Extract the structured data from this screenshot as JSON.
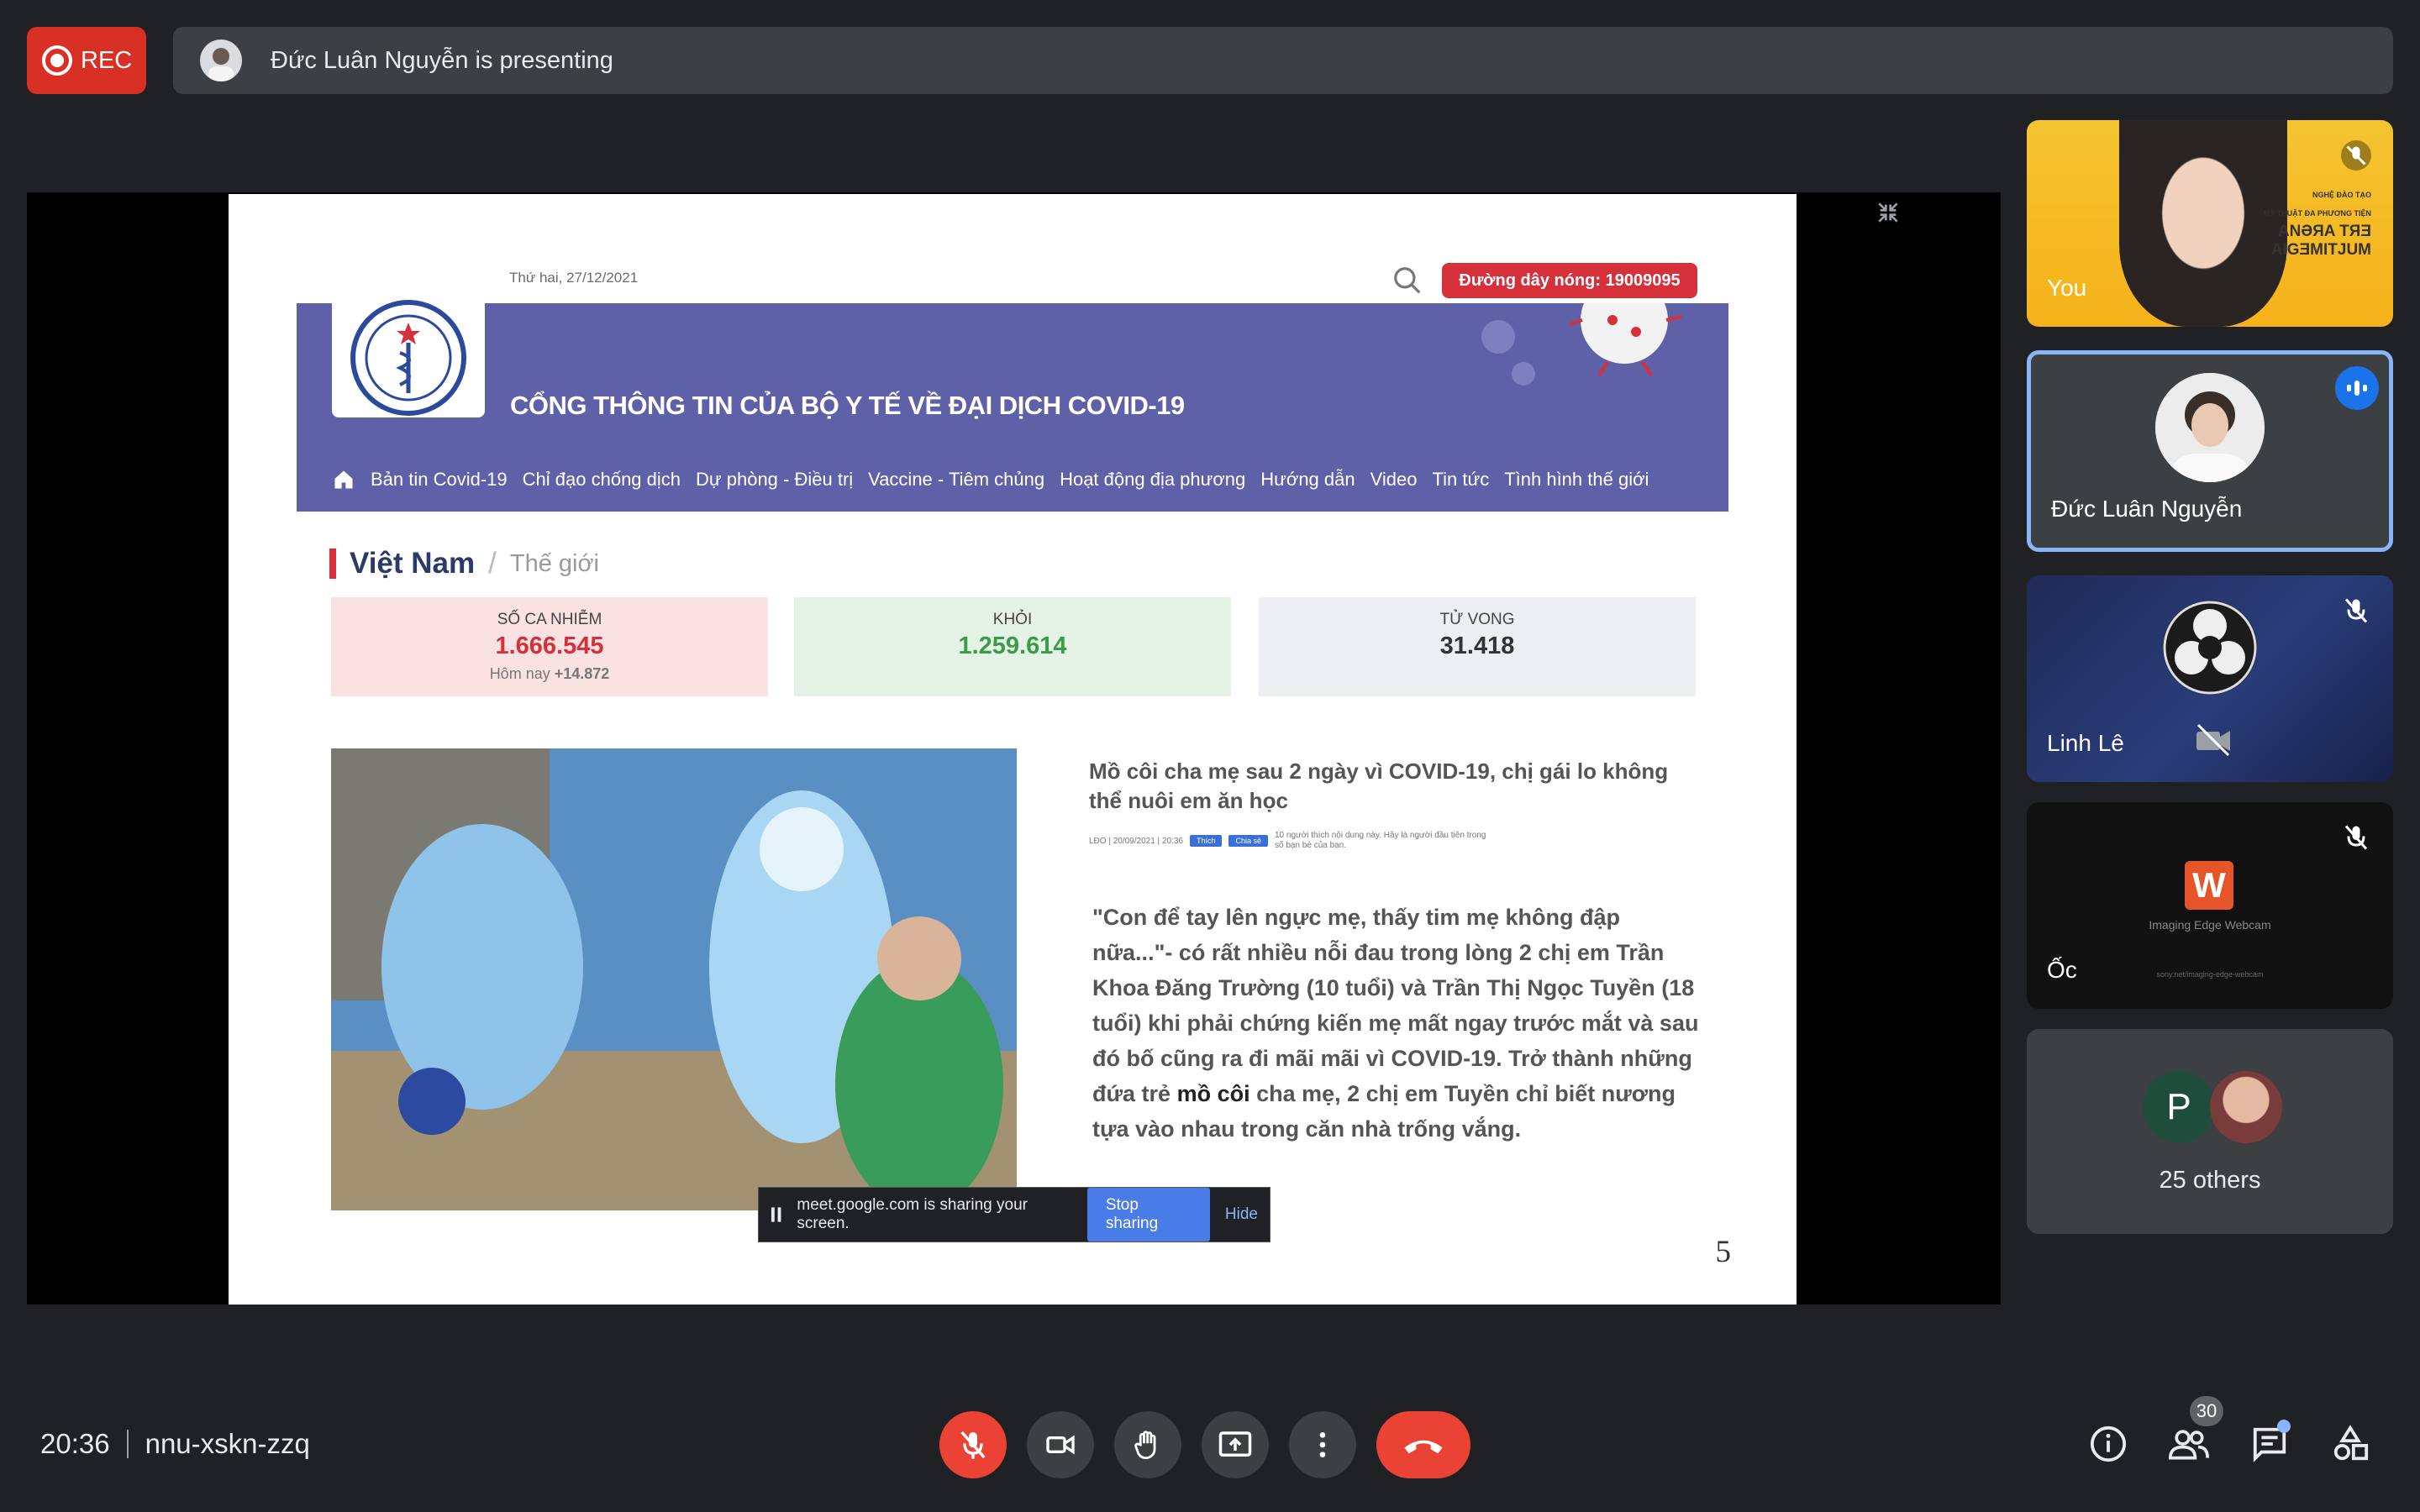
{
  "top": {
    "rec_label": "REC",
    "presenting_text": "Đức Luân Nguyễn is presenting"
  },
  "slide": {
    "date": "Thứ hai, 27/12/2021",
    "hotline": "Đường dây nóng: 19009095",
    "site_title": "CỔNG THÔNG TIN CỦA BỘ Y TẾ VỀ ĐẠI DỊCH COVID-19",
    "nav": [
      "Bản tin Covid-19",
      "Chỉ đạo chống dịch",
      "Dự phòng - Điều trị",
      "Vaccine - Tiêm chủng",
      "Hoạt động địa phương",
      "Hướng dẫn",
      "Video",
      "Tin tức",
      "Tình hình thế giới"
    ],
    "tab_active": "Việt Nam",
    "tab_sep": "/",
    "tab_inactive": "Thế giới",
    "stats": {
      "infected_label": "SỐ CA NHIỄM",
      "infected_value": "1.666.545",
      "infected_today_label": "Hôm nay",
      "infected_today_value": "+14.872",
      "recovered_label": "KHỎI",
      "recovered_value": "1.259.614",
      "deaths_label": "TỬ VONG",
      "deaths_value": "31.418"
    },
    "headline": "Mồ côi cha mẹ sau 2 ngày vì COVID-19, chị gái lo không thể nuôi em ăn học",
    "meta": "LĐO | 20/09/2021 | 20:36",
    "like_label": "Thích",
    "share_label": "Chia sẻ",
    "meta_note": "10 người thích nội dung này. Hãy là người đầu tiên trong số bạn bè của bạn.",
    "excerpt_before": "\"Con để tay lên ngực mẹ, thấy tim mẹ không đập nữa...\"- có rất nhiều nỗi đau trong lòng 2 chị em Trần Khoa Đăng Trường (10 tuổi) và Trần Thị Ngọc Tuyền (18 tuổi) khi phải chứng kiến mẹ mất ngay trước mắt và sau đó bố cũng ra đi mãi mãi vì COVID-19. Trở thành những đứa trẻ ",
    "excerpt_bold": "mồ côi",
    "excerpt_after": " cha mẹ, 2 chị em Tuyền chỉ biết nương tựa vào nhau trong căn nhà trống vắng.",
    "page_number": "5"
  },
  "share_bar": {
    "text": "meet.google.com is sharing your screen.",
    "stop": "Stop sharing",
    "hide": "Hide"
  },
  "participants": {
    "you": "You",
    "you_caption": [
      "NGHỆ ĐÀO TẠO",
      "MỸ THUẬT ĐA PHƯƠNG TIỆN",
      "ANƏЯA TЯƎ",
      "AIGƎMITJUM"
    ],
    "presenter": "Đức Luân Nguyễn",
    "linh": "Linh Lê",
    "oc": "Ốc",
    "oc_app": "Imaging Edge Webcam",
    "oc_sub": "sony.net/imaging-edge-webcam",
    "others_initial": "P",
    "others_label": "25 others"
  },
  "bottom": {
    "time": "20:36",
    "meeting_code": "nnu-xskn-zzq",
    "people_count": "30"
  },
  "colors": {
    "meet_bg": "#202124",
    "rec_red": "#d93025",
    "site_banner": "#5e60a8",
    "hotline_red": "#d6303a",
    "speaking_blue": "#1a73e8"
  }
}
